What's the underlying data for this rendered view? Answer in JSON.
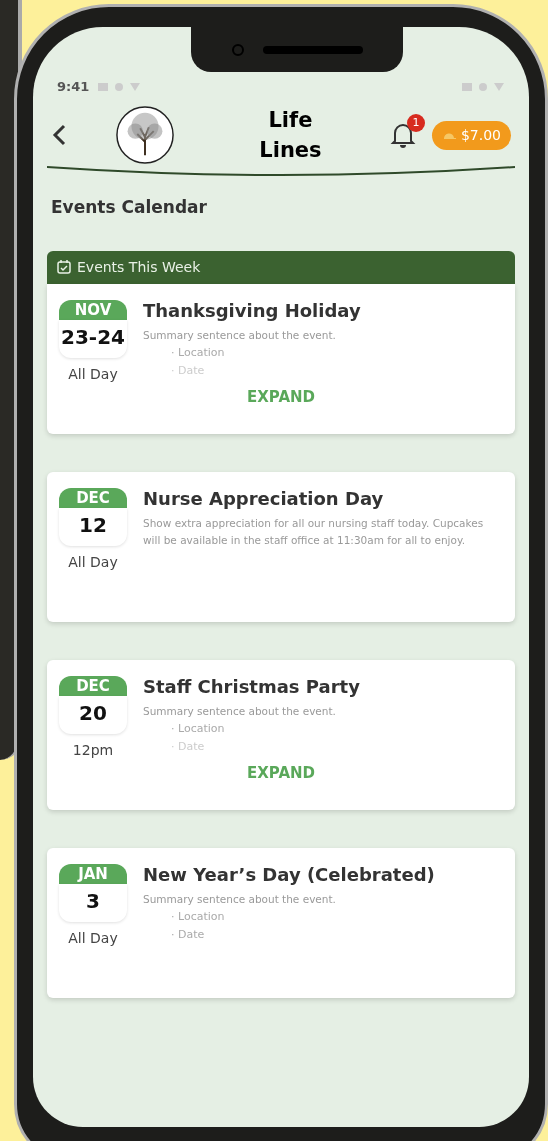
{
  "status_bar": {
    "time": "9:41"
  },
  "header": {
    "title_lines": [
      "Life",
      "Lines"
    ],
    "notifications": {
      "count": "1"
    },
    "balance": "$7.00"
  },
  "page_title": "Events Calendar",
  "week_banner": {
    "label": "Events This Week"
  },
  "events": [
    {
      "month": "NOV",
      "day": "23-24",
      "time": "All Day",
      "title": "Thanksgiving Holiday",
      "summary": "Summary sentence about the event.",
      "bullets": [
        {
          "marker": "·",
          "text": "Location"
        },
        {
          "marker": "·",
          "text": "Date"
        }
      ],
      "collapsed": true,
      "expand_label": "EXPAND",
      "in_week": true
    },
    {
      "month": "DEC",
      "day": "12",
      "time": "All Day",
      "title": "Nurse Appreciation Day",
      "summary": "Show extra appreciation for all our nursing staff today. Cupcakes will be available in the staff office at 11:30am for all to enjoy.",
      "collapsed": false,
      "in_week": false
    },
    {
      "month": "DEC",
      "day": "20",
      "time": "12pm",
      "title": "Staff Christmas Party",
      "summary": "Summary sentence about the event.",
      "bullets": [
        {
          "marker": "·",
          "text": "Location"
        },
        {
          "marker": "·",
          "text": "Date"
        }
      ],
      "collapsed": true,
      "expand_label": "EXPAND",
      "in_week": false
    },
    {
      "month": "JAN",
      "day": "3",
      "time": "All Day",
      "title": "New Year’s Day (Celebrated)",
      "summary": "Summary sentence about the event.",
      "bullets": [
        {
          "marker": "·",
          "text": "Location"
        },
        {
          "marker": "·",
          "text": "Date"
        }
      ],
      "collapsed": false,
      "in_week": false
    }
  ]
}
